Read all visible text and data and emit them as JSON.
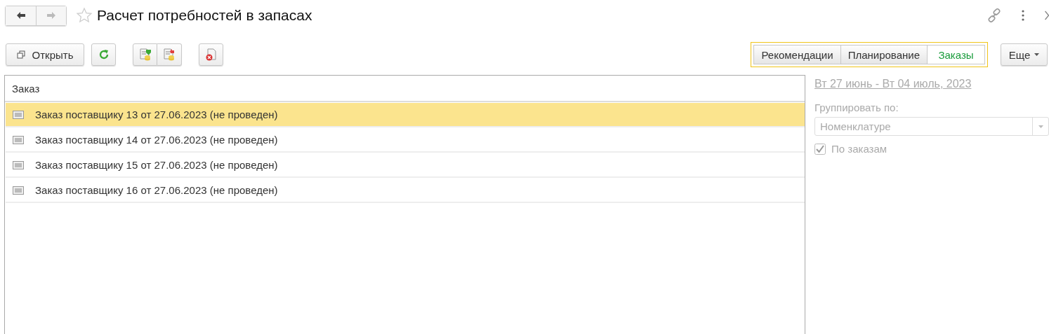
{
  "window": {
    "title": "Расчет потребностей в запасах",
    "favorite": false
  },
  "toolbar": {
    "open_button": "Открыть"
  },
  "tabs": [
    {
      "label": "Рекомендации",
      "selected": false
    },
    {
      "label": "Планирование",
      "selected": false
    },
    {
      "label": "Заказы",
      "selected": true
    }
  ],
  "more_button": "Еще",
  "table": {
    "columns": [
      "Заказ"
    ],
    "rows": [
      {
        "text": "Заказ поставщику 13 от 27.06.2023 (не проведен)",
        "selected": true
      },
      {
        "text": "Заказ поставщику 14 от 27.06.2023 (не проведен)",
        "selected": false
      },
      {
        "text": "Заказ поставщику 15 от 27.06.2023 (не проведен)",
        "selected": false
      },
      {
        "text": "Заказ поставщику 16 от 27.06.2023 (не проведен)",
        "selected": false
      }
    ]
  },
  "panel": {
    "period_link": "Вт 27 июнь - Вт 04 июль, 2023",
    "group_label": "Группировать по:",
    "group_field": {
      "value": "Номенклатуре",
      "disabled": true
    },
    "by_orders": {
      "label": "По заказам",
      "checked": true,
      "disabled": true
    }
  }
}
